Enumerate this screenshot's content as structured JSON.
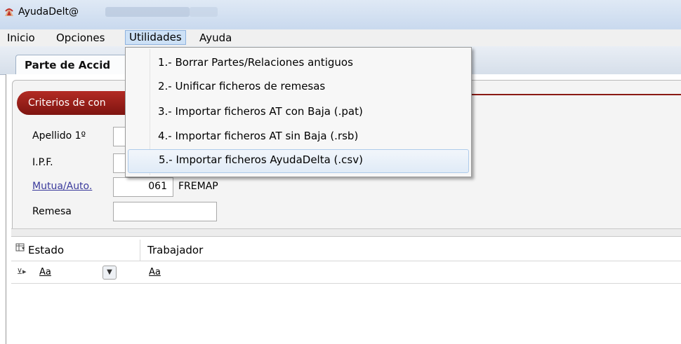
{
  "window": {
    "title": "AyudaDelt@",
    "icon": "app-logo-icon"
  },
  "menubar": {
    "items": [
      {
        "label": "Inicio"
      },
      {
        "label": "Opciones"
      },
      {
        "label": "Utilidades",
        "active": true
      },
      {
        "label": "Ayuda"
      }
    ]
  },
  "tab": {
    "label": "Parte de Accid"
  },
  "criteria": {
    "title": "Criterios de con"
  },
  "form": {
    "apellido_label": "Apellido 1º",
    "ipf_label": "I.P.F.",
    "mutua_label": "Mutua/Auto.",
    "mutua_code": "061",
    "mutua_name": "FREMAP",
    "remesa_label": "Remesa"
  },
  "grid": {
    "columns": [
      {
        "label": "Estado"
      },
      {
        "label": "Trabajador"
      }
    ],
    "filter_aa": "Aa"
  },
  "dropdown": {
    "items": [
      {
        "label": "1.- Borrar Partes/Relaciones antiguos"
      },
      {
        "label": "2.- Unificar ficheros de remesas"
      },
      {
        "label": "3.- Importar ficheros AT con Baja (.pat)"
      },
      {
        "label": "4.- Importar ficheros AT sin Baja (.rsb)"
      },
      {
        "label": "5.- Importar ficheros AyudaDelta (.csv)",
        "highlighted": true
      }
    ]
  },
  "colors": {
    "criteria_red": "#a2221c",
    "menu_highlight": "#cde1f6",
    "link": "#3b3b9c"
  }
}
